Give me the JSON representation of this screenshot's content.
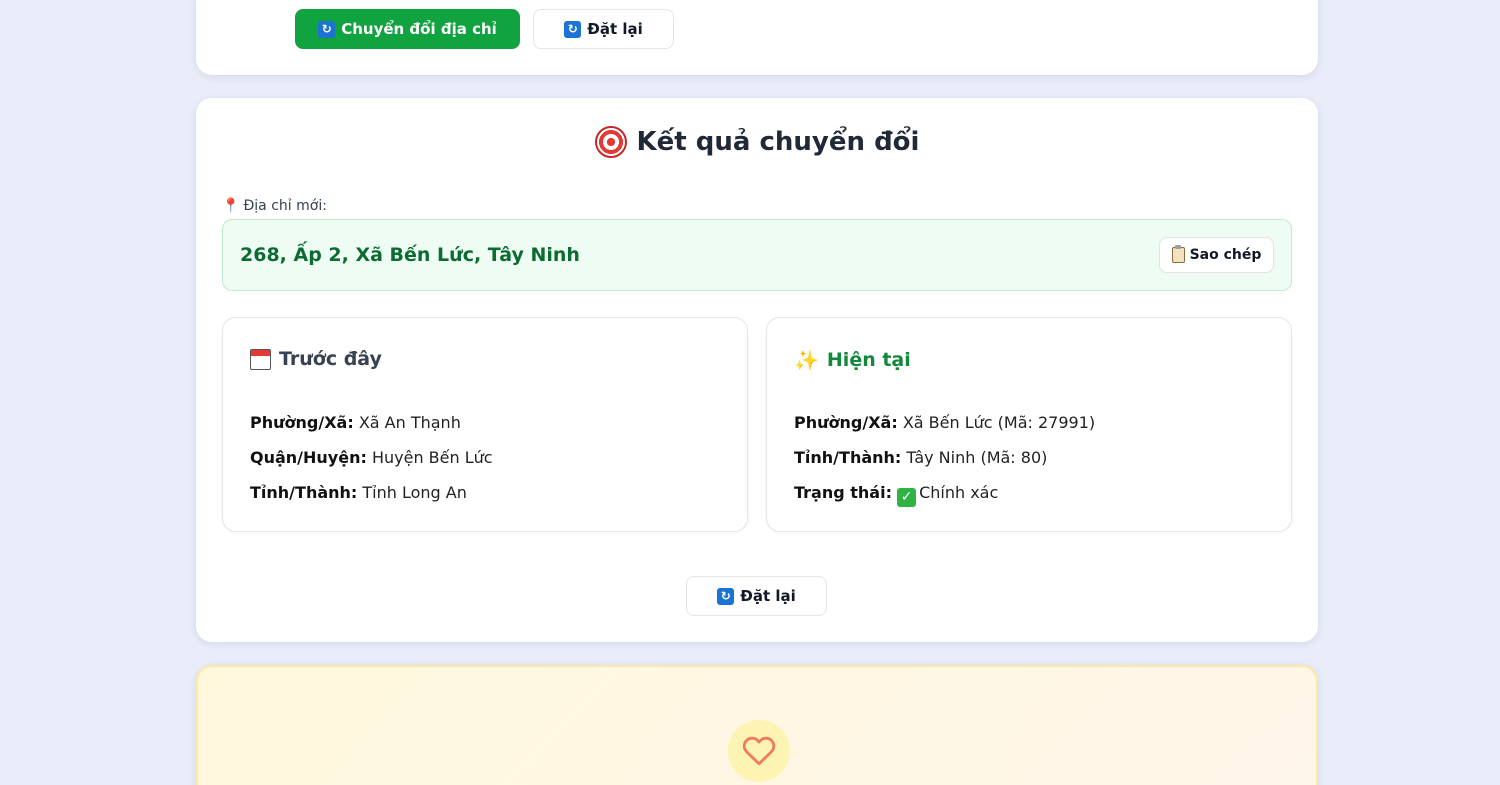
{
  "top_card": {
    "convert_label": "Chuyển đổi địa chỉ",
    "reset_label": "Đặt lại"
  },
  "result": {
    "title": "Kết quả chuyển đổi",
    "new_address_label": "Địa chỉ mới:",
    "new_address": "268, Ấp 2, Xã Bến Lức, Tây Ninh",
    "copy_label": "Sao chép",
    "before": {
      "title": "Trước đây",
      "ward_label": "Phường/Xã:",
      "ward_value": "Xã An Thạnh",
      "district_label": "Quận/Huyện:",
      "district_value": "Huyện Bến Lức",
      "province_label": "Tỉnh/Thành:",
      "province_value": "Tỉnh Long An"
    },
    "current": {
      "title": "Hiện tại",
      "ward_label": "Phường/Xã:",
      "ward_value": "Xã Bến Lức  (Mã: 27991)",
      "province_label": "Tỉnh/Thành:",
      "province_value": "Tây Ninh  (Mã: 80)",
      "status_label": "Trạng thái:",
      "status_value": "Chính xác"
    },
    "reset_label": "Đặt lại"
  },
  "colors": {
    "primary": "#10a33f",
    "success_text": "#0c6b32",
    "current_title": "#13873c",
    "heart": "#f07a62"
  },
  "icons": [
    "sync-icon",
    "target-icon",
    "pin-icon",
    "clipboard-icon",
    "calendar-icon",
    "sparkles-icon",
    "check-icon",
    "heart-icon"
  ]
}
